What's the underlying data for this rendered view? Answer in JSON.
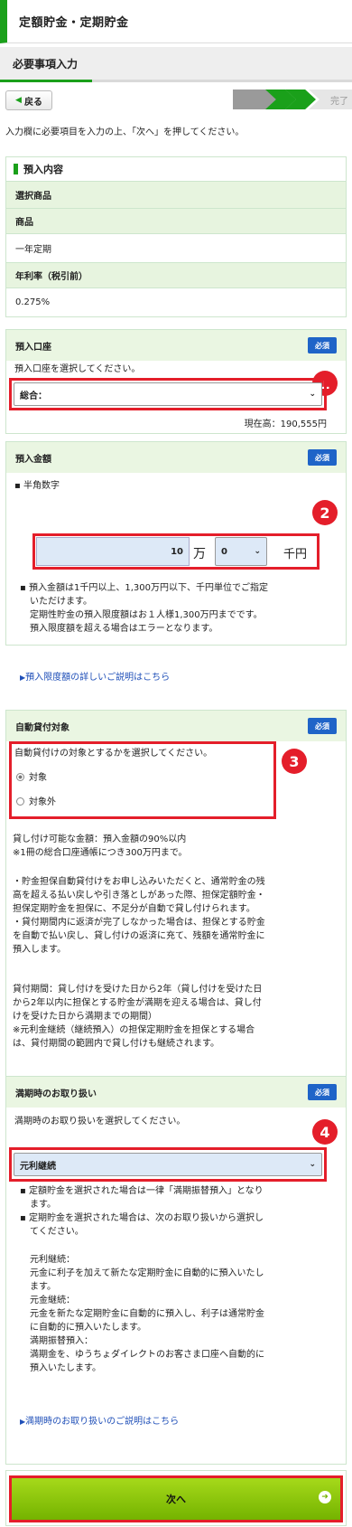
{
  "header": {
    "title": "定額貯金・定期貯金"
  },
  "subheader": {
    "title": "必要事項入力"
  },
  "nav": {
    "back_label": "戻る",
    "step_last_label": "完了"
  },
  "intro": "入力欄に必要項目を入力の上、「次へ」を押してください。",
  "deposit_section": {
    "title": "預入内容",
    "rows": [
      {
        "label": "選択商品",
        "header": true
      },
      {
        "label": "商品",
        "header": true
      },
      {
        "label": "一年定期",
        "header": false
      },
      {
        "label": "年利率（税引前）",
        "header": true
      },
      {
        "label": "0.275%",
        "header": false
      }
    ]
  },
  "account": {
    "title": "預入口座",
    "required": "必須",
    "instruction": "預入口座を選択してください。",
    "selected": "総合：",
    "balance": "現在高：190,555円",
    "marker": "1"
  },
  "amount": {
    "title": "預入金額",
    "required": "必須",
    "hint": "半角数字",
    "value_man": "10",
    "unit_man": "万",
    "value_sen": "0",
    "unit_sen": "千円",
    "marker": "2",
    "notes": [
      "預入金額は1千円以上、1,300万円以下、千円単位でご指定",
      "いただけます。",
      "定期性貯金の預入限度額はお１人様1,300万円までです。",
      "預入限度額を超える場合はエラーとなります。"
    ],
    "link": "預入限度額の詳しいご説明はこちら"
  },
  "auto_loan": {
    "title": "自動貸付対象",
    "required": "必須",
    "instruction": "自動貸付けの対象とするかを選択してください。",
    "options": [
      "対象",
      "対象外"
    ],
    "selected_index": 0,
    "marker": "3",
    "notes": [
      "貸し付け可能な金額：預入金額の90%以内",
      "※1冊の総合口座通帳につき300万円まで。",
      "",
      "・貯金担保自動貸付けをお申し込みいただくと、通常貯金の残",
      "高を超える払い戻しや引き落としがあった際、担保定額貯金・",
      "担保定期貯金を担保に、不足分が自動で貸し付けられます。",
      "・貸付期間内に返済が完了しなかった場合は、担保とする貯金",
      "を自動で払い戻し、貸し付けの返済に充て、残額を通常貯金に",
      "預入します。",
      "",
      "貸付期間：貸し付けを受けた日から2年（貸し付けを受けた日",
      "から2年以内に担保とする貯金が満期を迎える場合は、貸し付",
      "けを受けた日から満期までの期間）",
      "※元利金継続（継続預入）の担保定期貯金を担保とする場合",
      "は、貸付期間の範囲内で貸し付けも継続されます。"
    ]
  },
  "maturity": {
    "title": "満期時のお取り扱い",
    "required": "必須",
    "instruction": "満期時のお取り扱いを選択してください。",
    "selected": "元利継続",
    "marker": "4",
    "notes": [
      "定額貯金を選択された場合は一律「満期振替預入」となり",
      "ます。",
      "定期貯金を選択された場合は、次のお取り扱いから選択し",
      "てください。",
      "",
      "元利継続：",
      "元金に利子を加えて新たな定期貯金に自動的に預入いたし",
      "ます。",
      "元金継続：",
      "元金を新たな定期貯金に自動的に預入し、利子は通常貯金",
      "に自動的に預入いたします。",
      "満期振替預入：",
      "満期金を、ゆうちょダイレクトのお客さま口座へ自動的に",
      "預入いたします。"
    ],
    "link": "満期時のお取り扱いのご説明はこちら"
  },
  "next_button": {
    "label": "次へ"
  },
  "colors": {
    "accent_green": "#1aa01a",
    "required_blue": "#1f64c8",
    "marker_red": "#e41e2a"
  }
}
